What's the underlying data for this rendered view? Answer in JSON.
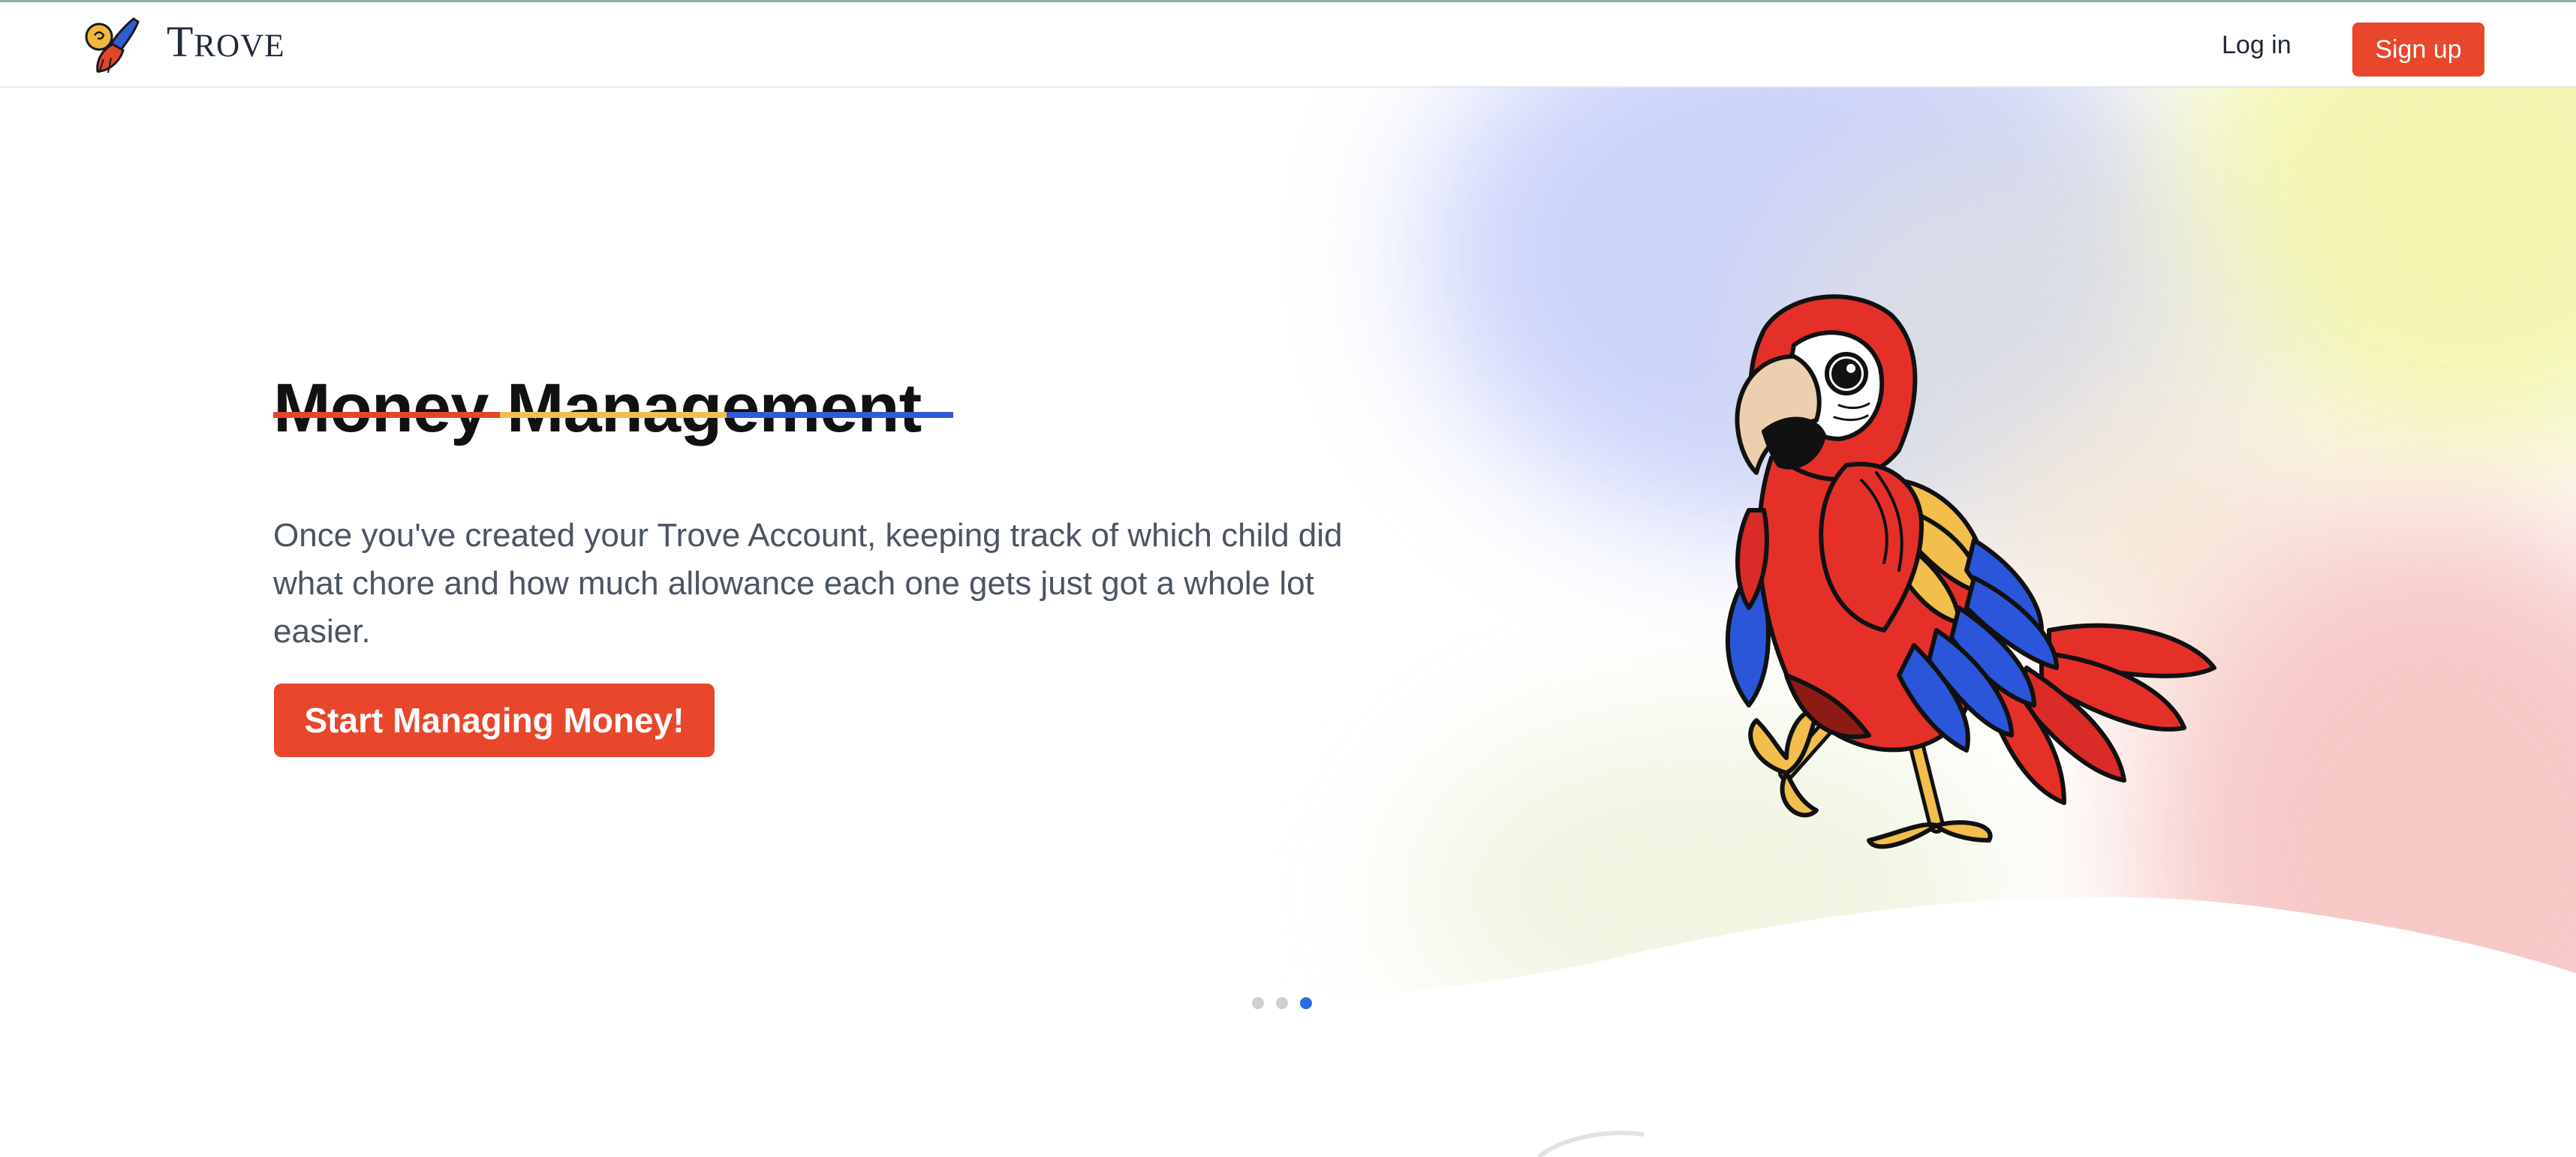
{
  "header": {
    "brand": "Trove",
    "login_label": "Log in",
    "signup_label": "Sign up",
    "accent_color": "#e8472c"
  },
  "hero": {
    "title": "Money Management",
    "description": "Once you've created your Trove Account, keeping track of which child did what chore and how much allowance each one gets just got a whole lot easier.",
    "cta_label": "Start Managing Money!",
    "underline_colors": [
      "#e5452b",
      "#f2be4c",
      "#2f5bd6"
    ]
  },
  "carousel": {
    "slides_total": 3,
    "active_slide": 3
  },
  "icons": {
    "logo": "trove-parrot-logo-icon",
    "illustration": "walking-parrot-illustration"
  }
}
